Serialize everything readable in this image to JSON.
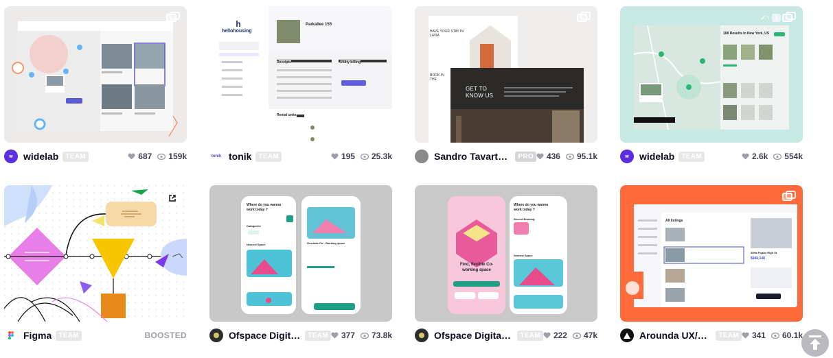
{
  "shots": [
    {
      "owner": "widelab",
      "badge": "TEAM",
      "likes": "687",
      "views": "159k",
      "avatar_color": "#5b2ee0",
      "avatar_text": "w"
    },
    {
      "owner": "tonik",
      "badge": "TEAM",
      "likes": "195",
      "views": "25.3k",
      "avatar_color": "#ffffff",
      "avatar_text": "tonik",
      "thumb_text": {
        "brand": "hellohousing",
        "address": "Parkallee 155",
        "receipts": "Receipts",
        "utility": "Utility billing",
        "rental": "Rental units"
      }
    },
    {
      "owner": "Sandro Tavartkil...",
      "badge": "PRO",
      "likes": "436",
      "views": "95.1k",
      "avatar_color": "#7a7a7a",
      "thumb_text": {
        "headline": "GET TO KNOW US",
        "top": "HAVE YOUR STAY IN LAVIA",
        "book": "BOOK IN THE"
      }
    },
    {
      "owner": "widelab",
      "badge": "TEAM",
      "likes": "2.6k",
      "views": "554k",
      "avatar_color": "#5b2ee0",
      "avatar_text": "w",
      "thumb_text": {
        "results": "108 Results in New York, US",
        "count": "1"
      }
    },
    {
      "owner": "Figma",
      "badge": "TEAM",
      "boosted": "BOOSTED",
      "avatar_color": "#ffffff"
    },
    {
      "owner": "Ofspace Digita...",
      "badge": "TEAM",
      "likes": "377",
      "views": "73.8k",
      "avatar_color": "#2d2d2d",
      "thumb_text": {
        "q": "Where do you wanna work today ?",
        "cat": "Categories",
        "near": "Nearest Space",
        "item": "Overlake Co - Working space"
      }
    },
    {
      "owner": "Ofspace Digital ...",
      "badge": "TEAM",
      "likes": "222",
      "views": "47k",
      "avatar_color": "#2d2d2d",
      "thumb_text": {
        "find": "Find, flexible Co-working space",
        "q": "Where do you wanna work today ?",
        "recent": "Recent Booking",
        "near": "Nearest Space"
      }
    },
    {
      "owner": "Arounda UX/UI,...",
      "badge": "TEAM",
      "likes": "341",
      "views": "60.1k",
      "avatar_color": "#111111",
      "thumb_text": {
        "all": "All listings",
        "addr": "30Ha Poplar High St",
        "price": "$946,148"
      }
    }
  ]
}
